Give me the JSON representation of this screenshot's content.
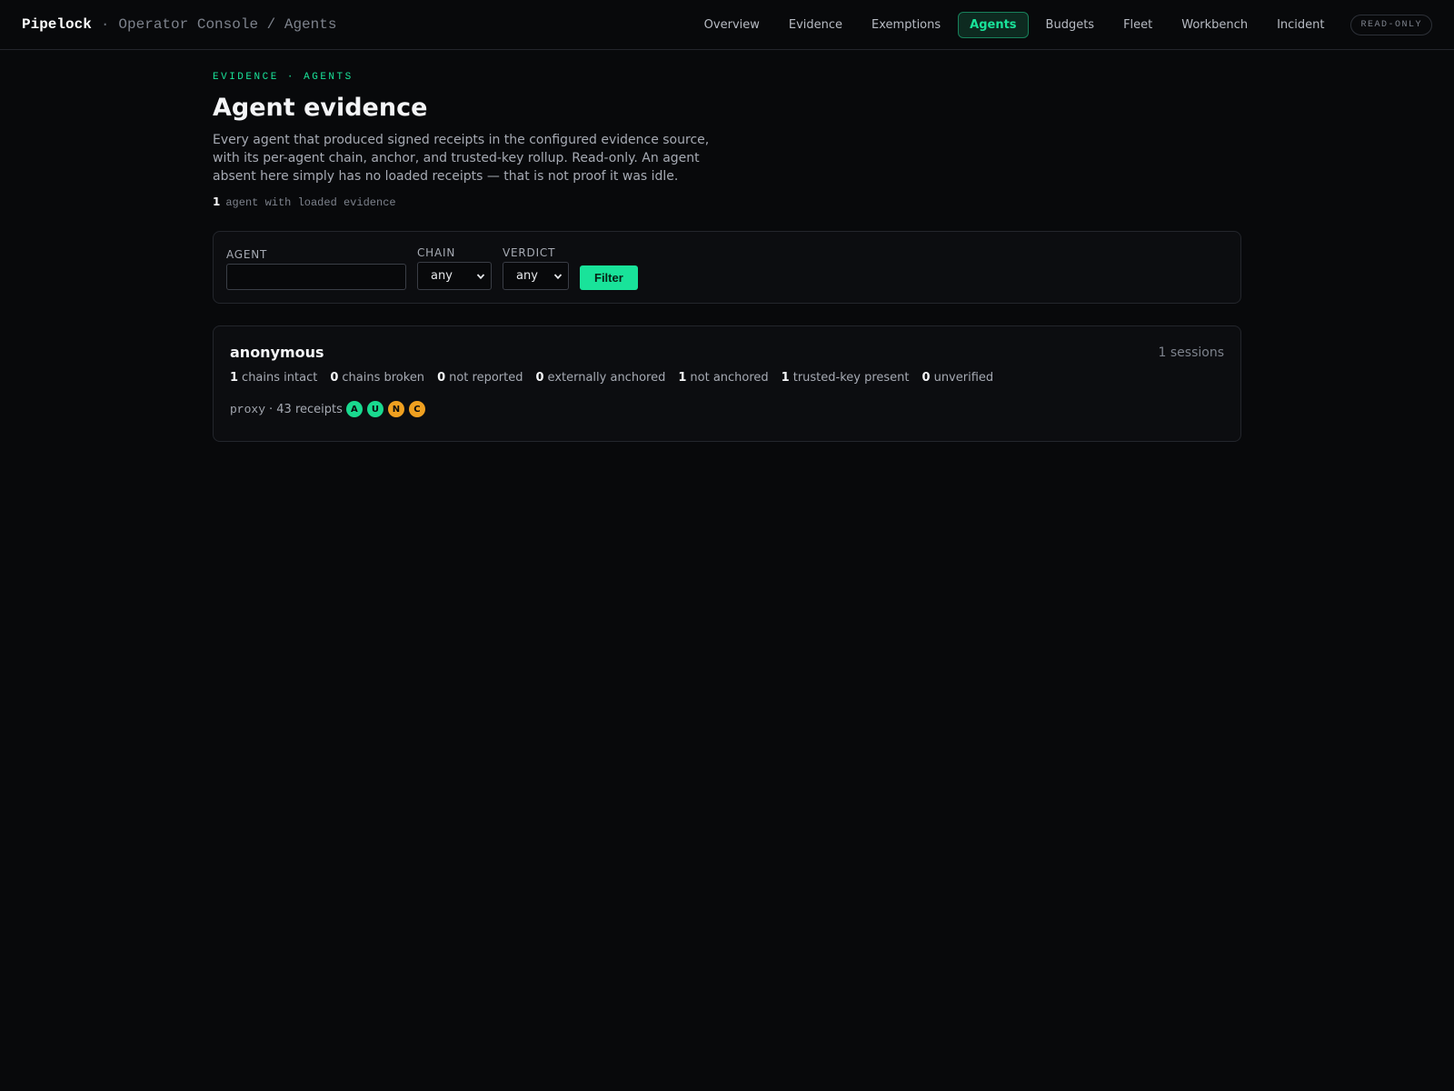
{
  "header": {
    "brand": "Pipelock",
    "separator": "·",
    "path": "Operator Console / Agents",
    "nav": [
      {
        "label": "Overview"
      },
      {
        "label": "Evidence"
      },
      {
        "label": "Exemptions"
      },
      {
        "label": "Agents",
        "active": true
      },
      {
        "label": "Budgets"
      },
      {
        "label": "Fleet"
      },
      {
        "label": "Workbench"
      },
      {
        "label": "Incident"
      }
    ],
    "mode_badge": "READ-ONLY"
  },
  "page": {
    "kicker": "EVIDENCE · AGENTS",
    "title": "Agent evidence",
    "description": "Every agent that produced signed receipts in the configured evidence source, with its per-agent chain, anchor, and trusted-key rollup. Read-only. An agent absent here simply has no loaded receipts — that is not proof it was idle.",
    "agent_count": "1",
    "agent_count_text": "agent with loaded evidence"
  },
  "filters": {
    "agent_label": "AGENT",
    "agent_value": "",
    "agent_placeholder": "",
    "chain_label": "CHAIN",
    "chain_value": "any",
    "verdict_label": "VERDICT",
    "verdict_value": "any",
    "submit_label": "Filter"
  },
  "agents": [
    {
      "name": "anonymous",
      "sessions": "1 sessions",
      "stats": [
        {
          "n": "1",
          "label": "chains intact"
        },
        {
          "n": "0",
          "label": "chains broken"
        },
        {
          "n": "0",
          "label": "not reported"
        },
        {
          "n": "0",
          "label": "externally anchored"
        },
        {
          "n": "1",
          "label": "not anchored"
        },
        {
          "n": "1",
          "label": "trusted-key present"
        },
        {
          "n": "0",
          "label": "unverified"
        }
      ],
      "source": "proxy",
      "receipts": "· 43 receipts",
      "badges": [
        {
          "letter": "A",
          "color": "#19d98f"
        },
        {
          "letter": "U",
          "color": "#19d98f"
        },
        {
          "letter": "N",
          "color": "#f0a020"
        },
        {
          "letter": "C",
          "color": "#f0a020"
        }
      ]
    }
  ]
}
